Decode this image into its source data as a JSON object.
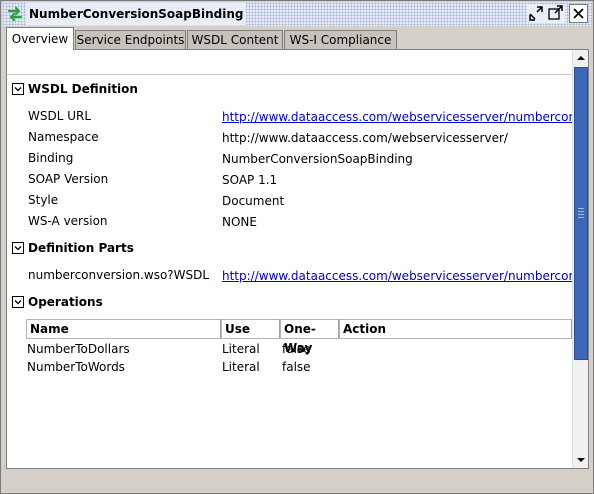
{
  "window": {
    "title": "NumberConversionSoapBinding",
    "icons": {
      "app": "swap-arrows-icon",
      "restore": "restore-icon",
      "maximize": "maximize-icon",
      "close": "close-icon"
    }
  },
  "tabs": [
    {
      "label": "Overview",
      "active": true
    },
    {
      "label": "Service Endpoints",
      "active": false
    },
    {
      "label": "WSDL Content",
      "active": false
    },
    {
      "label": "WS-I Compliance",
      "active": false
    }
  ],
  "sections": {
    "wsdl_definition": {
      "title": "WSDL Definition",
      "rows": [
        {
          "label": "WSDL URL",
          "value": "http://www.dataaccess.com/webservicesserver/numberconversion.wso?WSDL",
          "link": true
        },
        {
          "label": "Namespace",
          "value": "http://www.dataaccess.com/webservicesserver/",
          "link": false
        },
        {
          "label": "Binding",
          "value": "NumberConversionSoapBinding",
          "link": false
        },
        {
          "label": "SOAP Version",
          "value": "SOAP 1.1",
          "link": false
        },
        {
          "label": "Style",
          "value": "Document",
          "link": false
        },
        {
          "label": "WS-A version",
          "value": "NONE",
          "link": false
        }
      ]
    },
    "definition_parts": {
      "title": "Definition Parts",
      "rows": [
        {
          "label": "numberconversion.wso?WSDL",
          "value": "http://www.dataaccess.com/webservicesserver/numberconversion.wso?WSDL",
          "link": true
        }
      ]
    },
    "operations": {
      "title": "Operations",
      "columns": [
        "Name",
        "Use",
        "One-Way",
        "Action"
      ],
      "rows": [
        {
          "name": "NumberToDollars",
          "use": "Literal",
          "one_way": "false",
          "action": ""
        },
        {
          "name": "NumberToWords",
          "use": "Literal",
          "one_way": "false",
          "action": ""
        }
      ]
    }
  },
  "colors": {
    "link": "#0000cc",
    "scroll_thumb": "#3d68b6",
    "title_icon_green": "#2e9e3c"
  }
}
